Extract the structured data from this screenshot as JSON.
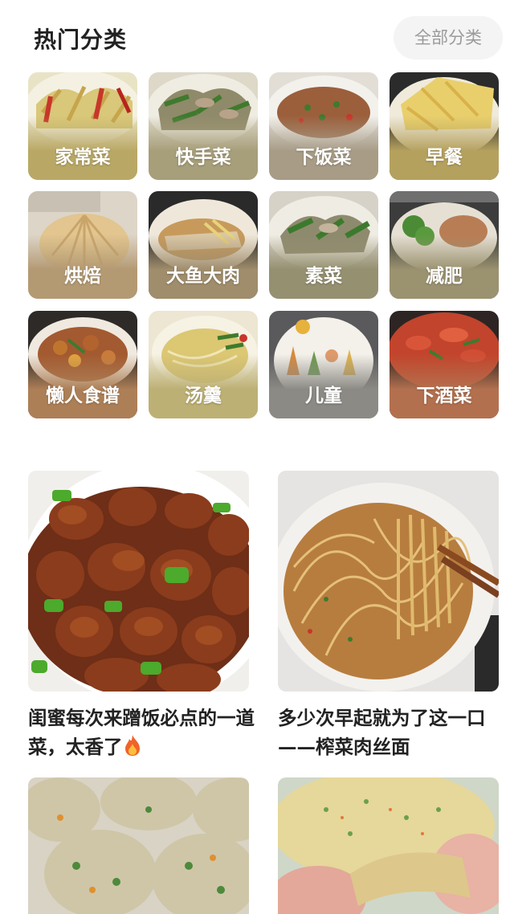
{
  "header": {
    "title": "热门分类",
    "all_button": "全部分类"
  },
  "categories": [
    {
      "label": "家常菜",
      "icon": "stir-fried-cabbage-photo",
      "tone": "#b9a865"
    },
    {
      "label": "快手菜",
      "icon": "stir-fried-meat-greens-photo",
      "tone": "#a79e7a"
    },
    {
      "label": "下饭菜",
      "icon": "minced-meat-dish-photo",
      "tone": "#a89c87"
    },
    {
      "label": "早餐",
      "icon": "egg-pancake-photo",
      "tone": "#b5a15e"
    },
    {
      "label": "烘焙",
      "icon": "bread-dough-photo",
      "tone": "#b49a73"
    },
    {
      "label": "大鱼大肉",
      "icon": "steamed-fish-photo",
      "tone": "#a08d6c"
    },
    {
      "label": "素菜",
      "icon": "vegetable-stir-fry-photo",
      "tone": "#959070"
    },
    {
      "label": "减肥",
      "icon": "broccoli-chicken-photo",
      "tone": "#9b9270"
    },
    {
      "label": "懒人食谱",
      "icon": "braised-chicken-photo",
      "tone": "#ad7f57"
    },
    {
      "label": "汤羹",
      "icon": "noodle-soup-photo",
      "tone": "#bdb074"
    },
    {
      "label": "儿童",
      "icon": "kids-plate-art-photo",
      "tone": "#8c8a84"
    },
    {
      "label": "下酒菜",
      "icon": "spicy-crayfish-photo",
      "tone": "#b3704e"
    }
  ],
  "feed": [
    {
      "title": "闺蜜每次来蹭饭必点的一道菜，太香了",
      "emoji": "fire-icon",
      "image": "pepper-ribs-photo"
    },
    {
      "title": "多少次早起就为了这一口——榨菜肉丝面",
      "image": "noodles-claypot-photo"
    }
  ],
  "feed_bottom": [
    {
      "image": "vegetable-dumplings-photo"
    },
    {
      "image": "vegetable-pancake-photo"
    }
  ]
}
